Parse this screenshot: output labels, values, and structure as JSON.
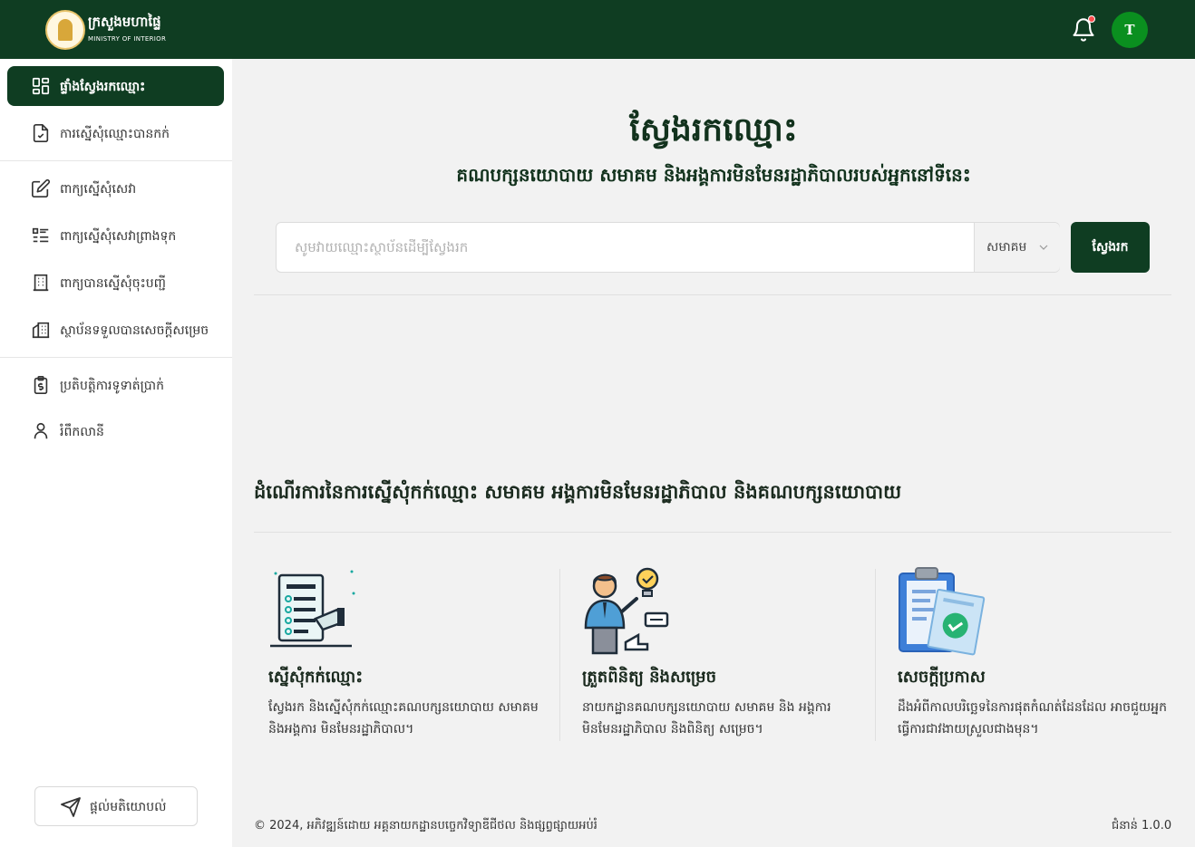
{
  "header": {
    "logo_title": "ក្រសួងមហាផ្ទៃ",
    "logo_subtitle": "MINISTRY OF INTERIOR",
    "avatar_initial": "T",
    "bell_icon": "bell-icon"
  },
  "sidebar": {
    "items": [
      {
        "label": "ផ្ទាំងស្វែងរកឈ្មោះ",
        "icon": "dashboard-grid-icon",
        "active": true
      },
      {
        "label": "ការស្នើសុំឈ្មោះបានកក់",
        "icon": "file-check-icon",
        "active": false
      },
      {
        "label": "ពាក្យស្នើសុំសេវា",
        "icon": "edit-icon",
        "active": false
      },
      {
        "label": "ពាក្យស្នើសុំសេវាព្រាងទុក",
        "icon": "list-icon",
        "active": false
      },
      {
        "label": "ពាក្យបានស្នើសុំចុះបញ្ជី",
        "icon": "building-icon",
        "active": false
      },
      {
        "label": "ស្ថាប័នទទួលបានសេចក្ដីសម្រេច",
        "icon": "buildings-icon",
        "active": false
      },
      {
        "label": "ប្រតិបត្តិការទូទាត់ប្រាក់",
        "icon": "payment-clipboard-icon",
        "active": false
      },
      {
        "label": "រំពឹកលានី",
        "icon": "user-icon",
        "active": false
      }
    ],
    "feedback_label": "ផ្ដល់មតិយោបល់",
    "feedback_icon": "send-icon"
  },
  "hero": {
    "title": "ស្វែងរកឈ្មោះ",
    "subtitle": "គណបក្សនយោបាយ សមាគម និងអង្គការមិនមែនរដ្ឋាភិបាលរបស់អ្នកនៅទីនេះ"
  },
  "search": {
    "placeholder": "សូមវាយឈ្មោះស្ថាប័នដើម្បីស្វែងរក",
    "value": "",
    "type_selected": "សមាគម",
    "button_label": "ស្វែងរក"
  },
  "process": {
    "title": "ដំណើរការនៃការស្នើសុំកក់ឈ្មោះ សមាគម អង្គការមិនមែនរដ្ឋាភិបាល និងគណបក្សនយោបាយ",
    "steps": [
      {
        "title": "ស្នើសុំកក់ឈ្មោះ",
        "description": "ស្វែងរក និងស្នើសុំកក់ឈ្មោះគណបក្សនយោបាយ សមាគម និងអង្គការ មិនមែនរដ្ឋាភិបាល។",
        "icon": "document-form-icon"
      },
      {
        "title": "ត្រួតពិនិត្យ និងសម្រេច",
        "description": "នាយកដ្ឋានគណបក្សនយោបាយ សមាគម និង អង្គការមិនមែនរដ្ឋាភិបាល និងពិនិត្យ សម្រេច។",
        "icon": "reviewer-person-icon"
      },
      {
        "title": "សេចក្ដីប្រកាស",
        "description": "ដឹងអំពីកាលបរិច្ឆេទនៃការផុតកំណត់ដែនដែល អាចជួយអ្នកធ្វើការជាវងាយស្រួលជាងមុន។",
        "icon": "clipboard-approved-icon"
      }
    ]
  },
  "footer": {
    "copyright": "© 2024, អភិវឌ្ឍន៍ដោយ  អគ្គនាយកដ្ឋានបច្ចេកវិទ្យាឌីជីថល និងផ្សព្វផ្សាយអប់រំ",
    "version": "ជំនាន់ 1.0.0"
  },
  "colors": {
    "primary": "#0f3d22",
    "avatar": "#0a8f1f",
    "notification_dot": "#ff4d4d",
    "background": "#f2f2f2"
  }
}
